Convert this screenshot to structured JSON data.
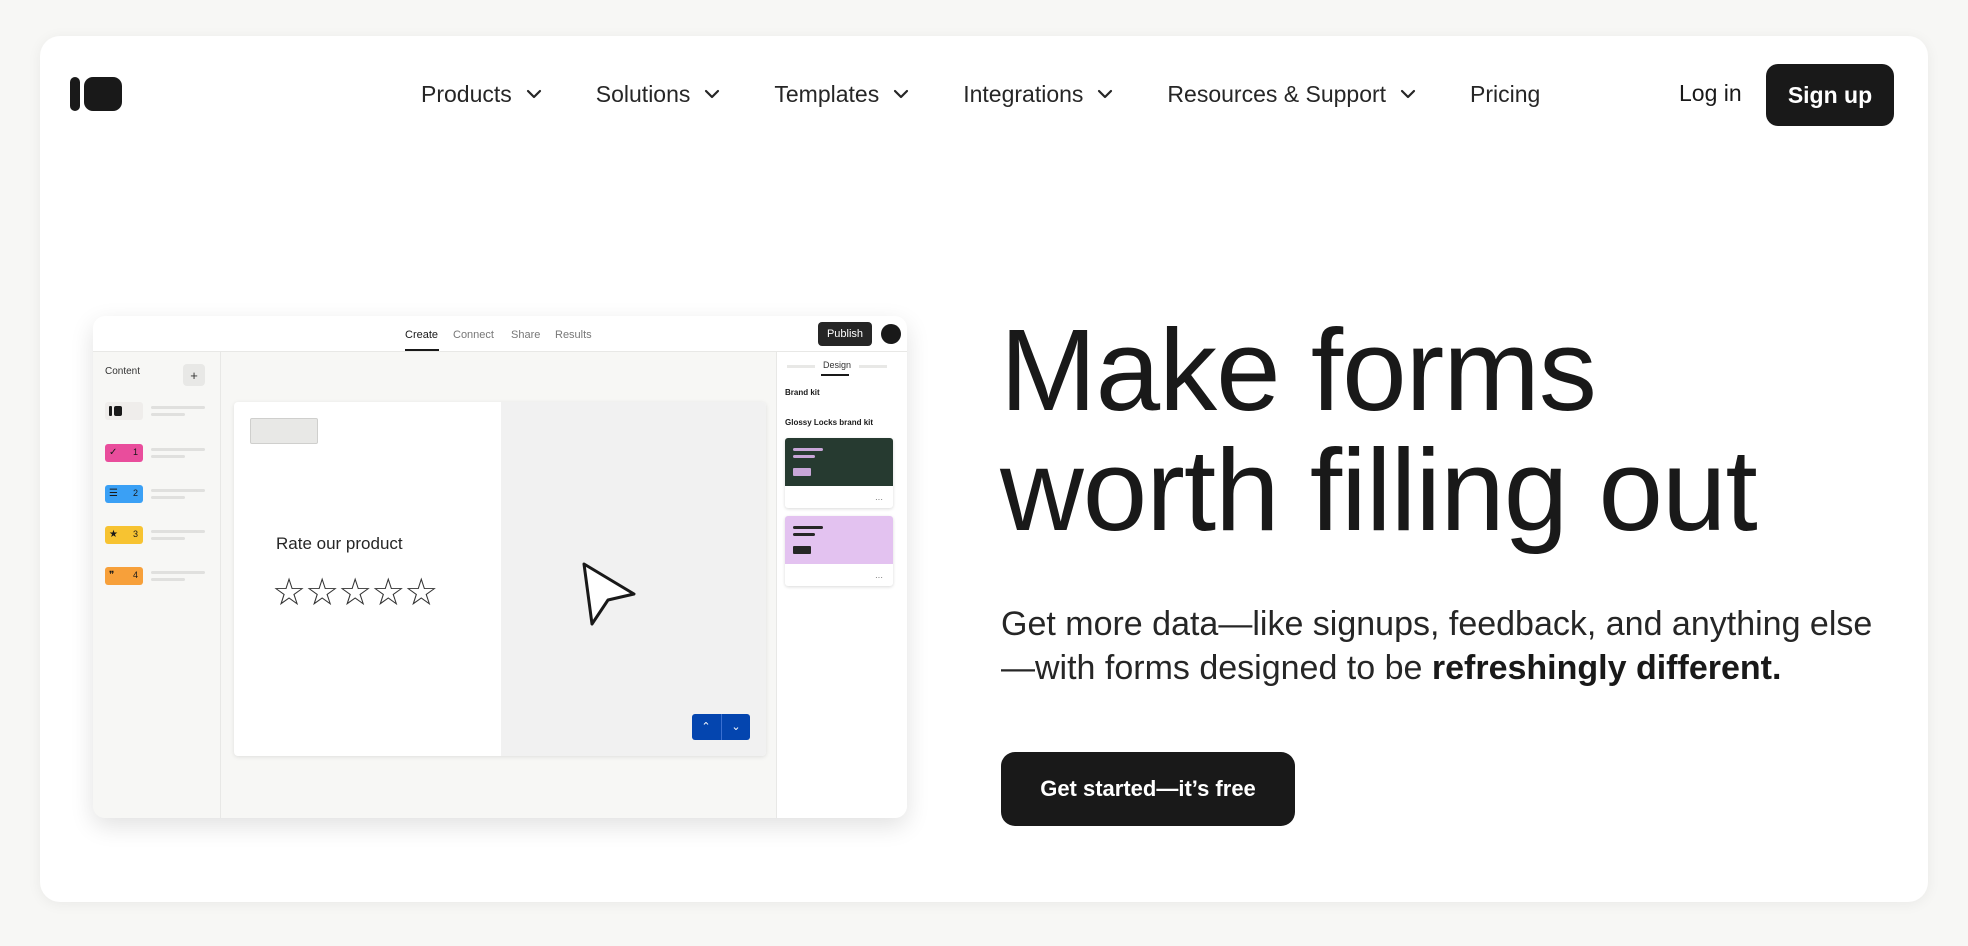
{
  "nav": {
    "items": [
      {
        "label": "Products"
      },
      {
        "label": "Solutions"
      },
      {
        "label": "Templates"
      },
      {
        "label": "Integrations"
      },
      {
        "label": "Resources & Support"
      },
      {
        "label": "Pricing"
      }
    ],
    "login_label": "Log in",
    "signup_label": "Sign up"
  },
  "hero": {
    "headline_line1": "Make forms",
    "headline_line2": "worth filling out",
    "subtext_part1": "Get more data—like signups, feedback, and anything else—with forms designed to be ",
    "subtext_bold": "refreshingly different.",
    "cta_label": "Get started—it’s free"
  },
  "mockup": {
    "tabs": [
      "Create",
      "Connect",
      "Share",
      "Results"
    ],
    "publish_label": "Publish",
    "sidebar_title": "Content",
    "add_label": "+",
    "question_items": [
      {
        "icon": "check",
        "num": "1",
        "color": "#e94d9c"
      },
      {
        "icon": "list",
        "num": "2",
        "color": "#3aa0f5"
      },
      {
        "icon": "★",
        "num": "3",
        "color": "#f7c331"
      },
      {
        "icon": "❞",
        "num": "4",
        "color": "#f7a03a"
      }
    ],
    "question_text": "Rate our product",
    "stars": "☆☆☆☆☆",
    "design_tab": "Design",
    "brand_kit_label": "Brand kit",
    "brand_kit_name": "Glossy Locks brand kit",
    "card_menu": "···",
    "nav_up": "⌃",
    "nav_down": "⌄",
    "colors": {
      "card1_bg": "#263a30",
      "card1_accent": "#c8a6d8",
      "card2_bg": "#e3c2f0",
      "card2_accent": "#262626"
    }
  }
}
